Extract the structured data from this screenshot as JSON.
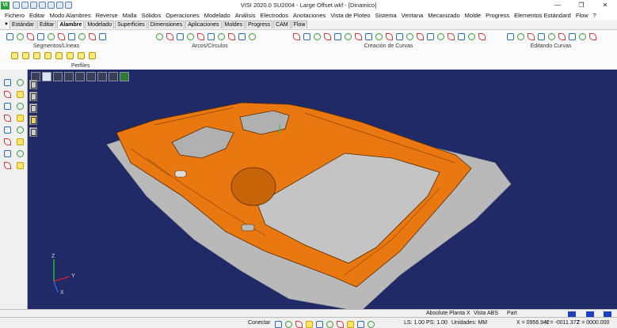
{
  "app": {
    "logo_text": "Vi",
    "title": "VISI 2020.0 SU2004 - Large Offset.wkf - [Dinamico]",
    "window_controls": [
      "—",
      "❐",
      "✕"
    ]
  },
  "menu": [
    "Fichero",
    "Editar",
    "Modo Alambres",
    "Reverse",
    "Malla",
    "Sólidos",
    "Operaciones",
    "Modelado",
    "Análisis",
    "Electrodos",
    "Anotaciones",
    "Vista de Ploteo",
    "Sistema",
    "Ventana",
    "Mecanizado",
    "Molde",
    "Progress",
    "Elementos Estándard",
    "Flow",
    "?"
  ],
  "ribbon": {
    "tabs": [
      "Estándar",
      "Editar",
      "Alambre",
      "Modelado",
      "Superficies",
      "Dimensiones",
      "Aplicaciones",
      "Moldes",
      "Progress",
      "CAM",
      "Flow"
    ],
    "active_tab": "Alambre",
    "groups": [
      {
        "label": "Segmentos/Líneas",
        "icon_count": 10
      },
      {
        "label": "Arcos/Círculos",
        "icon_count": 10
      },
      {
        "label": "Creación de Curvas",
        "icon_count": 19
      },
      {
        "label": "Editando Curvas",
        "icon_count": 9
      }
    ],
    "profiles": {
      "label": "Perfiles",
      "icon_count": 8
    }
  },
  "viewport": {
    "axes": {
      "z": "Z",
      "y": "Y",
      "x": "X"
    },
    "colors": {
      "background": "#1f2a66",
      "model": "#e8780f",
      "mesh": "#b9b9b9",
      "edges": "#5a2a00"
    }
  },
  "status": {
    "view_plane": "Absolute Planta X",
    "view_name": "Vista ABS",
    "mode": "Part",
    "connect": "Conectar",
    "ls_ps": "LS: 1.00 PS: 1.00",
    "units": "Unidades: MM",
    "x": "X = 0956.942",
    "y": "Y = -0011.372",
    "z": "Z = 0000.000"
  }
}
